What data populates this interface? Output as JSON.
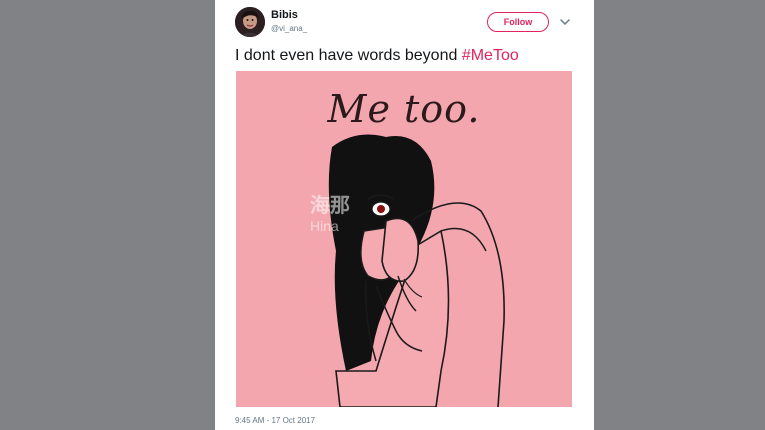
{
  "tweet": {
    "author": {
      "display_name": "Bibis",
      "handle": "@vi_ana_"
    },
    "follow_label": "Follow",
    "text_prefix": "I dont even have words beyond ",
    "hashtag": "#MeToo",
    "media": {
      "caption": "Me too.",
      "watermark_cjk": "海那",
      "watermark_latin": "Hina"
    },
    "timestamp": "9:45 AM - 17 Oct 2017"
  },
  "colors": {
    "accent": "#e0245e",
    "media_background": "#f3a6ad",
    "page_background": "#808285"
  },
  "icons": {
    "more": "chevron-down-icon"
  }
}
